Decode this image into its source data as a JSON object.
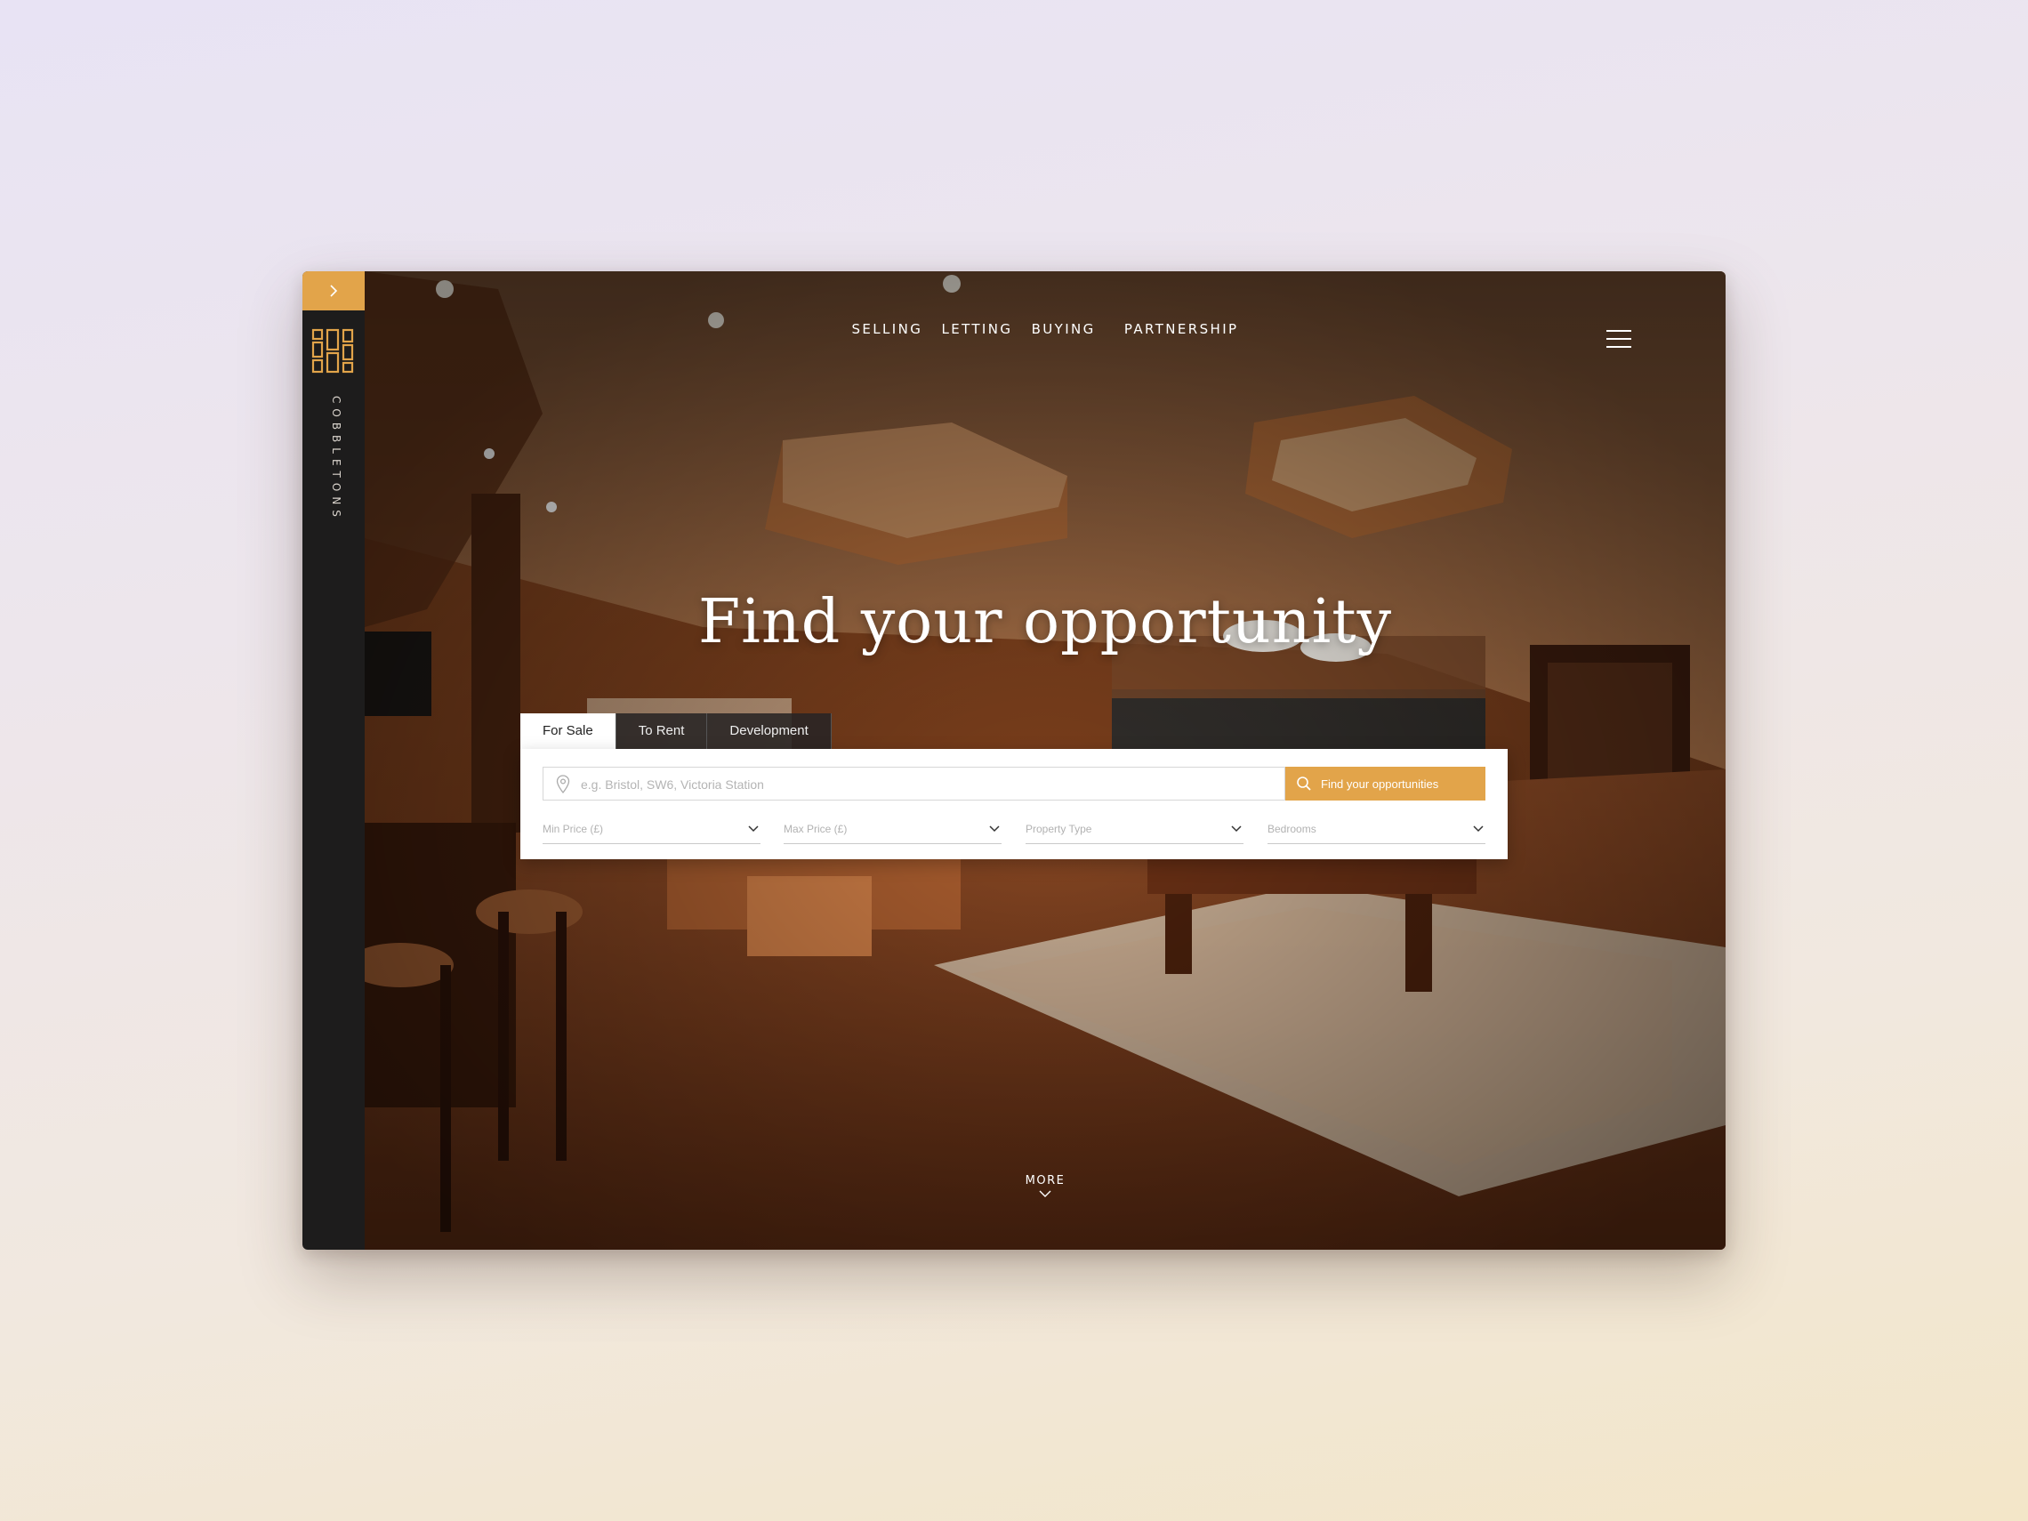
{
  "brand": {
    "name": "COBBLETONS",
    "accent": "#e2a44a"
  },
  "nav": {
    "items": [
      "SELLING",
      "LETTING",
      "BUYING",
      "PARTNERSHIP"
    ]
  },
  "hero": {
    "headline": "Find your opportunity",
    "more_label": "MORE"
  },
  "search": {
    "tabs": [
      {
        "label": "For Sale",
        "active": true
      },
      {
        "label": "To Rent",
        "active": false
      },
      {
        "label": "Development",
        "active": false
      }
    ],
    "placeholder": "e.g. Bristol, SW6, Victoria Station",
    "button_label": "Find your opportunities",
    "filters": [
      {
        "label": "Min Price (£)"
      },
      {
        "label": "Max Price (£)"
      },
      {
        "label": "Property Type"
      },
      {
        "label": "Bedrooms"
      }
    ]
  },
  "icons": {
    "sidebar_toggle": "chevron-right-icon",
    "logo": "grid-logo-icon",
    "menu": "hamburger-icon",
    "location": "map-pin-icon",
    "search": "search-icon",
    "dropdown": "chevron-down-icon",
    "more": "chevron-down-icon"
  }
}
